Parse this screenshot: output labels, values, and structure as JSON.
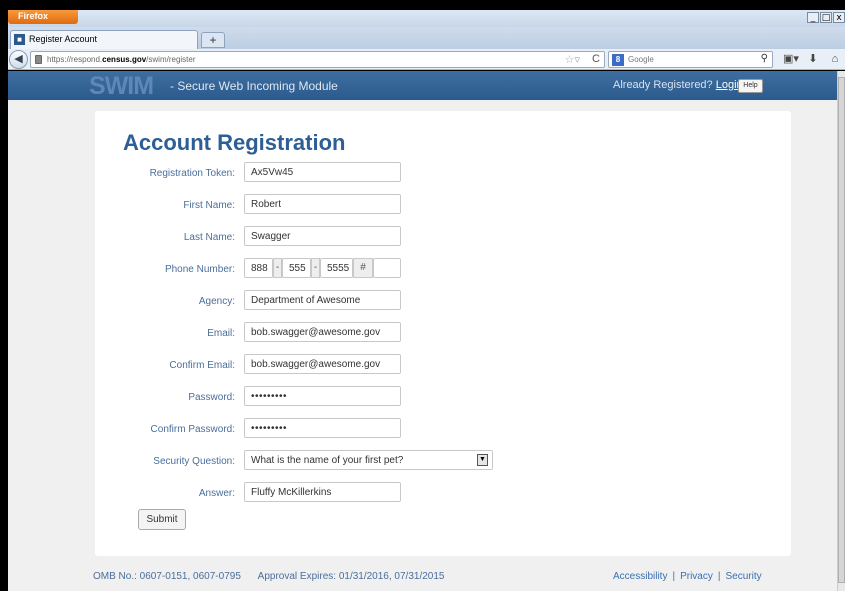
{
  "browser": {
    "app_button": "Firefox",
    "window_controls": [
      "_",
      "□",
      "x"
    ],
    "tab_title": "Register Account",
    "new_tab": "+",
    "url_prefix": "https://respond.",
    "url_domain": "census.gov",
    "url_path": "/swim/register",
    "search_engine": "Google"
  },
  "header": {
    "logo": "SWIM",
    "subtitle": "- Secure Web Incoming Module",
    "already_registered": "Already Registered?",
    "login": "Login",
    "help": "Help"
  },
  "form": {
    "title": "Account Registration",
    "token": {
      "label": "Registration Token:",
      "value": "Ax5Vw45"
    },
    "first_name": {
      "label": "First Name:",
      "value": "Robert"
    },
    "last_name": {
      "label": "Last Name:",
      "value": "Swagger"
    },
    "phone": {
      "label": "Phone Number:",
      "area": "888",
      "prefix": "555",
      "line": "5555",
      "ext_placeholder": "#"
    },
    "agency": {
      "label": "Agency:",
      "value": "Department of Awesome"
    },
    "email": {
      "label": "Email:",
      "value": "bob.swagger@awesome.gov"
    },
    "confirm_email": {
      "label": "Confirm Email:",
      "value": "bob.swagger@awesome.gov"
    },
    "password": {
      "label": "Password:",
      "value": "•••••••••"
    },
    "confirm_password": {
      "label": "Confirm Password:",
      "value": "•••••••••"
    },
    "security_question": {
      "label": "Security Question:",
      "value": "What is the name of your first pet?"
    },
    "answer": {
      "label": "Answer:",
      "value": "Fluffy McKillerkins"
    },
    "submit": "Submit"
  },
  "footer": {
    "omb": "OMB No.: 0607-0151, 0607-0795",
    "approval": "Approval Expires: 01/31/2016, 07/31/2015",
    "links": [
      "Accessibility",
      "Privacy",
      "Security"
    ],
    "separator": "|"
  }
}
